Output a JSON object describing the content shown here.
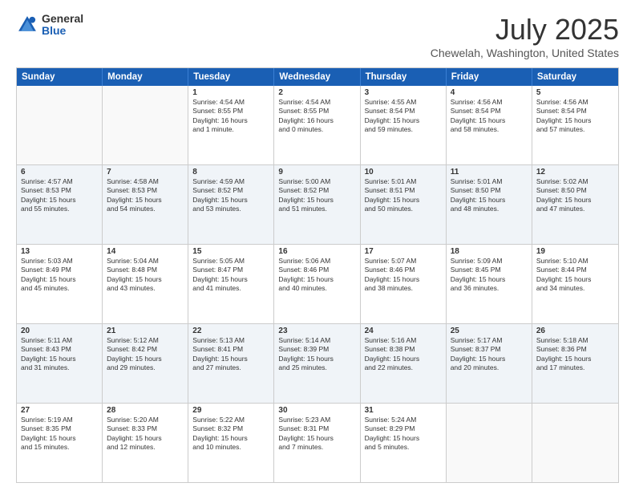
{
  "logo": {
    "general": "General",
    "blue": "Blue"
  },
  "header": {
    "title": "July 2025",
    "subtitle": "Chewelah, Washington, United States"
  },
  "weekdays": [
    "Sunday",
    "Monday",
    "Tuesday",
    "Wednesday",
    "Thursday",
    "Friday",
    "Saturday"
  ],
  "rows": [
    [
      {
        "day": "",
        "info": ""
      },
      {
        "day": "",
        "info": ""
      },
      {
        "day": "1",
        "info": "Sunrise: 4:54 AM\nSunset: 8:55 PM\nDaylight: 16 hours\nand 1 minute."
      },
      {
        "day": "2",
        "info": "Sunrise: 4:54 AM\nSunset: 8:55 PM\nDaylight: 16 hours\nand 0 minutes."
      },
      {
        "day": "3",
        "info": "Sunrise: 4:55 AM\nSunset: 8:54 PM\nDaylight: 15 hours\nand 59 minutes."
      },
      {
        "day": "4",
        "info": "Sunrise: 4:56 AM\nSunset: 8:54 PM\nDaylight: 15 hours\nand 58 minutes."
      },
      {
        "day": "5",
        "info": "Sunrise: 4:56 AM\nSunset: 8:54 PM\nDaylight: 15 hours\nand 57 minutes."
      }
    ],
    [
      {
        "day": "6",
        "info": "Sunrise: 4:57 AM\nSunset: 8:53 PM\nDaylight: 15 hours\nand 55 minutes."
      },
      {
        "day": "7",
        "info": "Sunrise: 4:58 AM\nSunset: 8:53 PM\nDaylight: 15 hours\nand 54 minutes."
      },
      {
        "day": "8",
        "info": "Sunrise: 4:59 AM\nSunset: 8:52 PM\nDaylight: 15 hours\nand 53 minutes."
      },
      {
        "day": "9",
        "info": "Sunrise: 5:00 AM\nSunset: 8:52 PM\nDaylight: 15 hours\nand 51 minutes."
      },
      {
        "day": "10",
        "info": "Sunrise: 5:01 AM\nSunset: 8:51 PM\nDaylight: 15 hours\nand 50 minutes."
      },
      {
        "day": "11",
        "info": "Sunrise: 5:01 AM\nSunset: 8:50 PM\nDaylight: 15 hours\nand 48 minutes."
      },
      {
        "day": "12",
        "info": "Sunrise: 5:02 AM\nSunset: 8:50 PM\nDaylight: 15 hours\nand 47 minutes."
      }
    ],
    [
      {
        "day": "13",
        "info": "Sunrise: 5:03 AM\nSunset: 8:49 PM\nDaylight: 15 hours\nand 45 minutes."
      },
      {
        "day": "14",
        "info": "Sunrise: 5:04 AM\nSunset: 8:48 PM\nDaylight: 15 hours\nand 43 minutes."
      },
      {
        "day": "15",
        "info": "Sunrise: 5:05 AM\nSunset: 8:47 PM\nDaylight: 15 hours\nand 41 minutes."
      },
      {
        "day": "16",
        "info": "Sunrise: 5:06 AM\nSunset: 8:46 PM\nDaylight: 15 hours\nand 40 minutes."
      },
      {
        "day": "17",
        "info": "Sunrise: 5:07 AM\nSunset: 8:46 PM\nDaylight: 15 hours\nand 38 minutes."
      },
      {
        "day": "18",
        "info": "Sunrise: 5:09 AM\nSunset: 8:45 PM\nDaylight: 15 hours\nand 36 minutes."
      },
      {
        "day": "19",
        "info": "Sunrise: 5:10 AM\nSunset: 8:44 PM\nDaylight: 15 hours\nand 34 minutes."
      }
    ],
    [
      {
        "day": "20",
        "info": "Sunrise: 5:11 AM\nSunset: 8:43 PM\nDaylight: 15 hours\nand 31 minutes."
      },
      {
        "day": "21",
        "info": "Sunrise: 5:12 AM\nSunset: 8:42 PM\nDaylight: 15 hours\nand 29 minutes."
      },
      {
        "day": "22",
        "info": "Sunrise: 5:13 AM\nSunset: 8:41 PM\nDaylight: 15 hours\nand 27 minutes."
      },
      {
        "day": "23",
        "info": "Sunrise: 5:14 AM\nSunset: 8:39 PM\nDaylight: 15 hours\nand 25 minutes."
      },
      {
        "day": "24",
        "info": "Sunrise: 5:16 AM\nSunset: 8:38 PM\nDaylight: 15 hours\nand 22 minutes."
      },
      {
        "day": "25",
        "info": "Sunrise: 5:17 AM\nSunset: 8:37 PM\nDaylight: 15 hours\nand 20 minutes."
      },
      {
        "day": "26",
        "info": "Sunrise: 5:18 AM\nSunset: 8:36 PM\nDaylight: 15 hours\nand 17 minutes."
      }
    ],
    [
      {
        "day": "27",
        "info": "Sunrise: 5:19 AM\nSunset: 8:35 PM\nDaylight: 15 hours\nand 15 minutes."
      },
      {
        "day": "28",
        "info": "Sunrise: 5:20 AM\nSunset: 8:33 PM\nDaylight: 15 hours\nand 12 minutes."
      },
      {
        "day": "29",
        "info": "Sunrise: 5:22 AM\nSunset: 8:32 PM\nDaylight: 15 hours\nand 10 minutes."
      },
      {
        "day": "30",
        "info": "Sunrise: 5:23 AM\nSunset: 8:31 PM\nDaylight: 15 hours\nand 7 minutes."
      },
      {
        "day": "31",
        "info": "Sunrise: 5:24 AM\nSunset: 8:29 PM\nDaylight: 15 hours\nand 5 minutes."
      },
      {
        "day": "",
        "info": ""
      },
      {
        "day": "",
        "info": ""
      }
    ]
  ]
}
